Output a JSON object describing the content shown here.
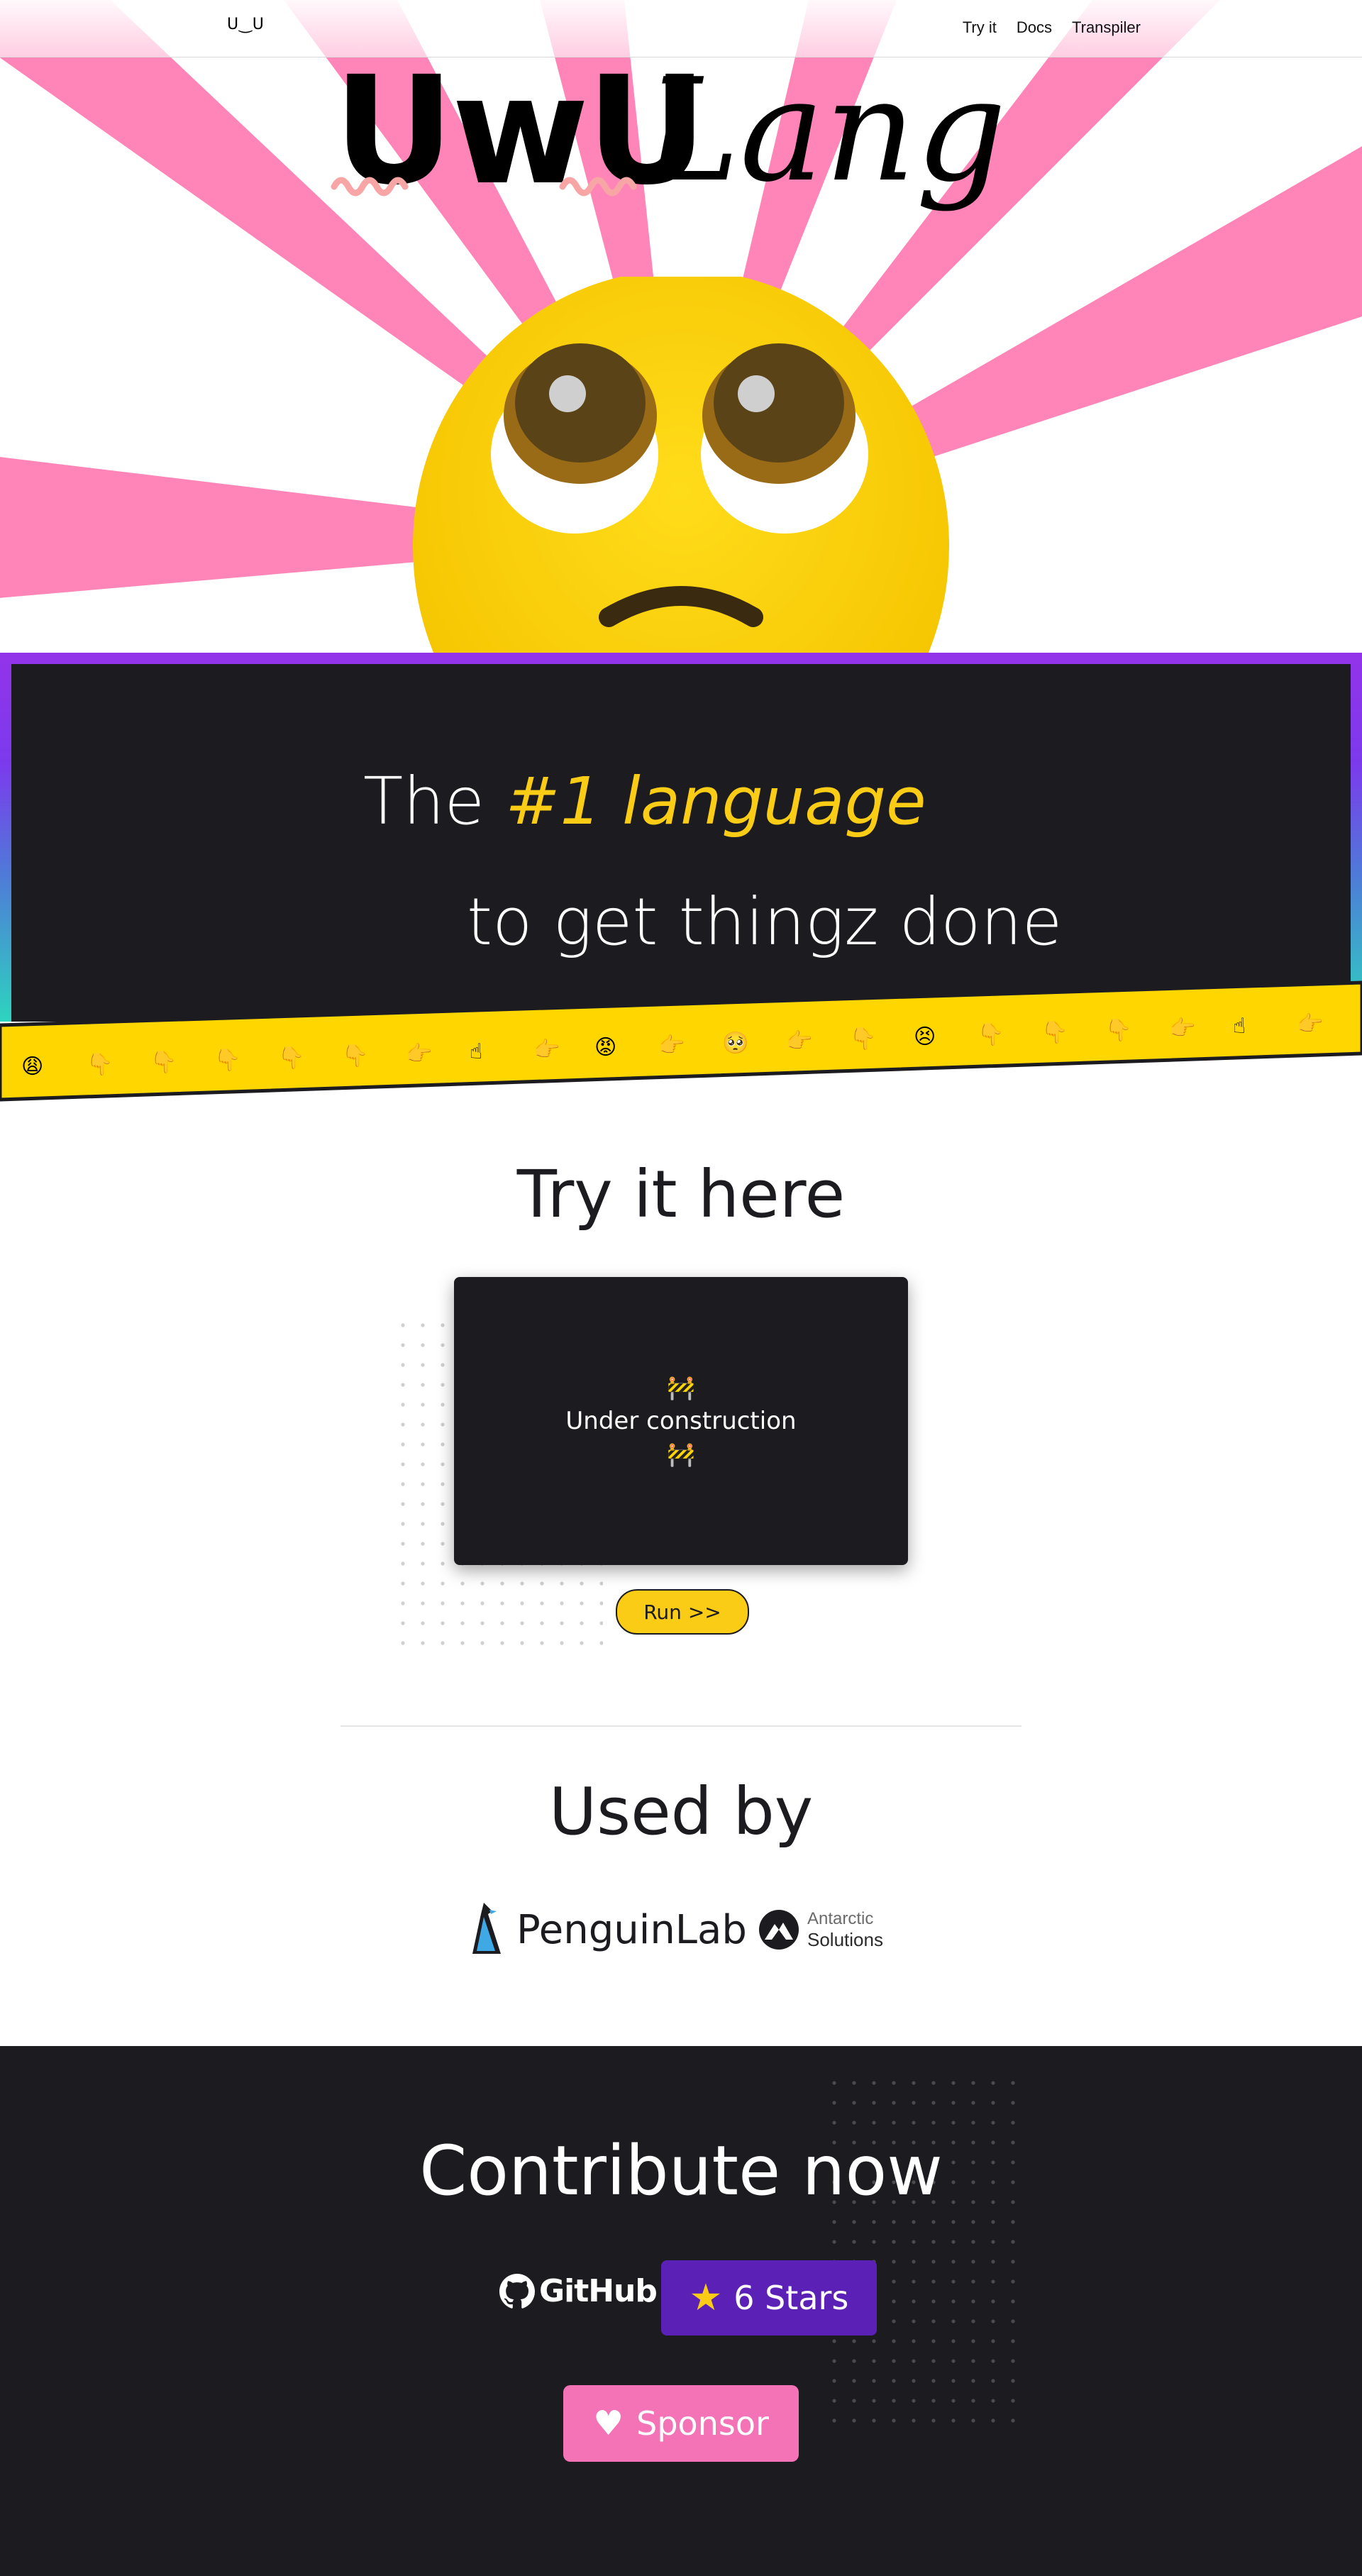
{
  "nav": {
    "brand": "U‿U",
    "links": [
      "Try it",
      "Docs",
      "Transpiler"
    ]
  },
  "hero": {
    "logo_uwu": "UwU",
    "logo_lang": "Lang"
  },
  "tagline": {
    "prefix": "The ",
    "highlight": "#1 language",
    "line2": "to get thingz done"
  },
  "try_section": {
    "title": "Try it here",
    "editor_icon": "🚧",
    "editor_message": "Under construction",
    "run_label": "Run >>"
  },
  "used_by": {
    "title": "Used by",
    "companies": [
      {
        "name": "PenguinLab",
        "icon": "penguin-icon"
      },
      {
        "name_line1": "Antarctic",
        "name_line2": "Solutions",
        "icon": "mountain-icon"
      }
    ]
  },
  "contribute": {
    "title": "Contribute now",
    "github_label": "GitHub",
    "stars_label": "6 Stars",
    "sponsor_label": "Sponsor"
  },
  "colors": {
    "pink": "#ff85b8",
    "yellow": "#ffd600",
    "dark": "#1c1b1f",
    "purple": "#5b21b6",
    "sponsor": "#f472b6"
  }
}
